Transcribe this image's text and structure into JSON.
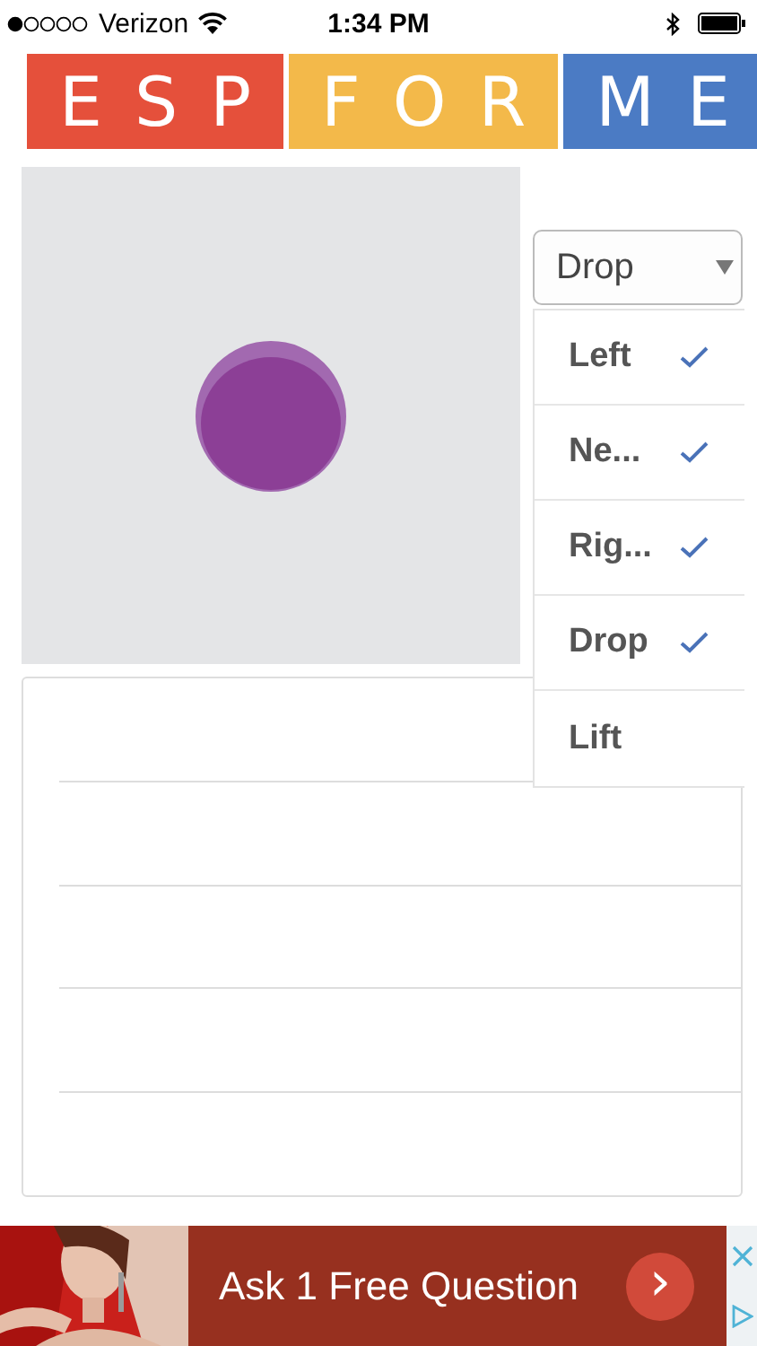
{
  "status_bar": {
    "carrier": "Verizon",
    "time": "1:34 PM"
  },
  "logo": [
    {
      "text": "ESP",
      "color": "#e5503b"
    },
    {
      "text": "FOR",
      "color": "#f3b94a"
    },
    {
      "text": "ME",
      "color": "#4b7bc4"
    }
  ],
  "dropdown": {
    "value": "Drop",
    "expanded": true,
    "options": [
      {
        "label": "Left",
        "checked": true
      },
      {
        "label": "Ne...",
        "checked": true
      },
      {
        "label": "Rig...",
        "checked": true
      },
      {
        "label": "Drop",
        "checked": true
      },
      {
        "label": "Lift",
        "checked": false
      }
    ]
  },
  "ad": {
    "text": "Ask 1 Free Question",
    "button": "›"
  }
}
